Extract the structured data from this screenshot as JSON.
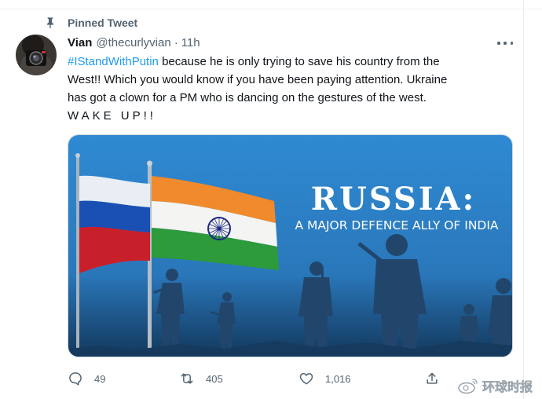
{
  "pinned_label": "Pinned Tweet",
  "author": {
    "name": "Vian",
    "handle": "@thecurlyvian",
    "separator": "·",
    "time": "11h"
  },
  "tweet": {
    "hashtag": "#IStandWithPutin",
    "line1_rest": " because he is only trying to save his country from the",
    "line2": "West!! Which you would know if you have been paying attention. Ukraine",
    "line3": "has got a clown for a PM who is dancing on the gestures of the west.",
    "line4": "WAKE UP!!"
  },
  "media": {
    "headline": "RUSSIA:",
    "subheadline": "A MAJOR DEFENCE ALLY OF INDIA"
  },
  "actions": {
    "replies": "49",
    "retweets": "405",
    "likes": "1,016"
  },
  "watermark": "环球时报",
  "colors": {
    "accent": "#1d9bf0",
    "secondary_text": "#536471",
    "poster_blue": "#2e7fc6"
  }
}
